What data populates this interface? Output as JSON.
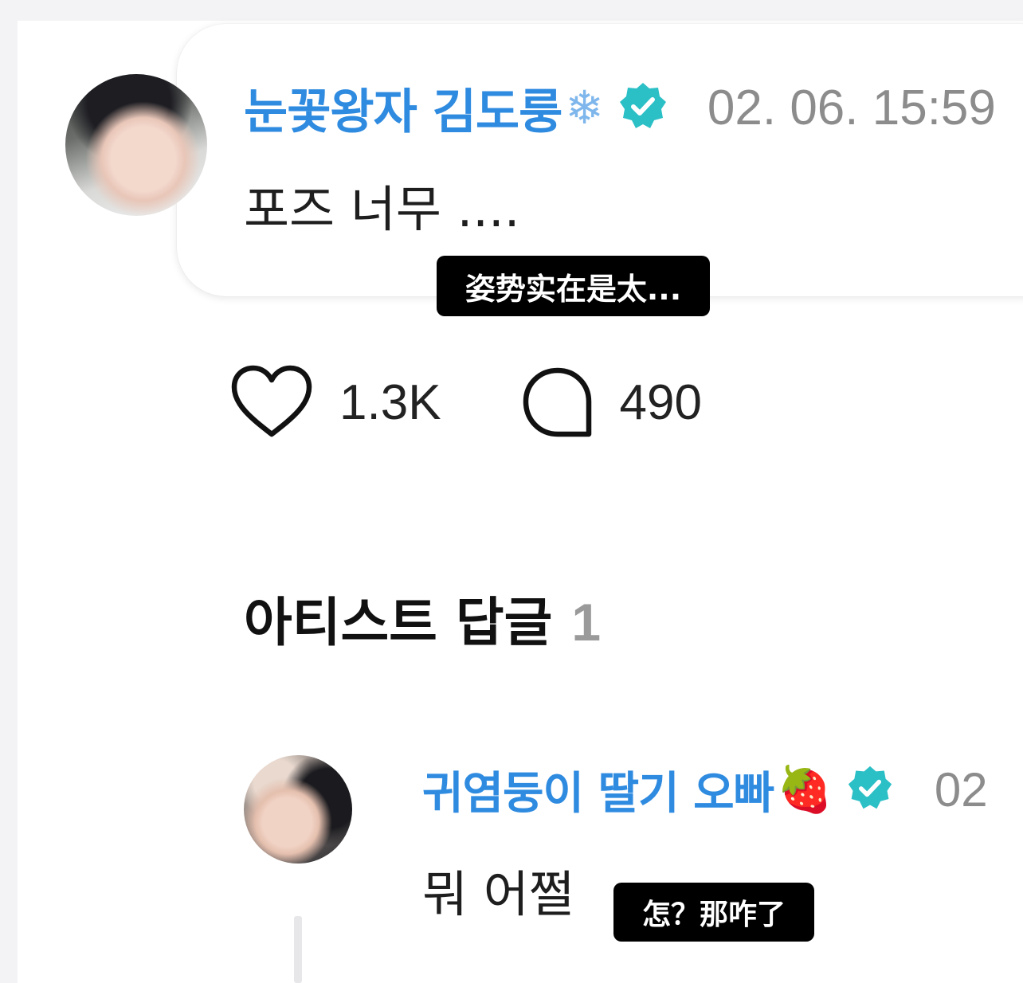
{
  "comment": {
    "author": "눈꽃왕자 김도룽",
    "author_emoji": "❄",
    "timestamp": "02. 06. 15:59",
    "text": "포즈 너무 ....",
    "subtitle": "姿势实在是太...",
    "likes": "1.3K",
    "replies": "490"
  },
  "artist_replies": {
    "label": "아티스트 답글",
    "count": "1"
  },
  "reply": {
    "author": "귀염둥이 딸기 오빠",
    "author_emoji": "🍓",
    "timestamp": "02",
    "text": "뭐 어쩔",
    "subtitle": "怎？那咋了"
  },
  "icons": [
    "heart-icon",
    "comment-bubble-icon",
    "verified-badge-icon"
  ],
  "colors": {
    "author_name": "#2f8be0",
    "verified_badge": "#2bbfc6",
    "timestamp": "#8c8c8c",
    "subtitle_bg": "#000000"
  }
}
